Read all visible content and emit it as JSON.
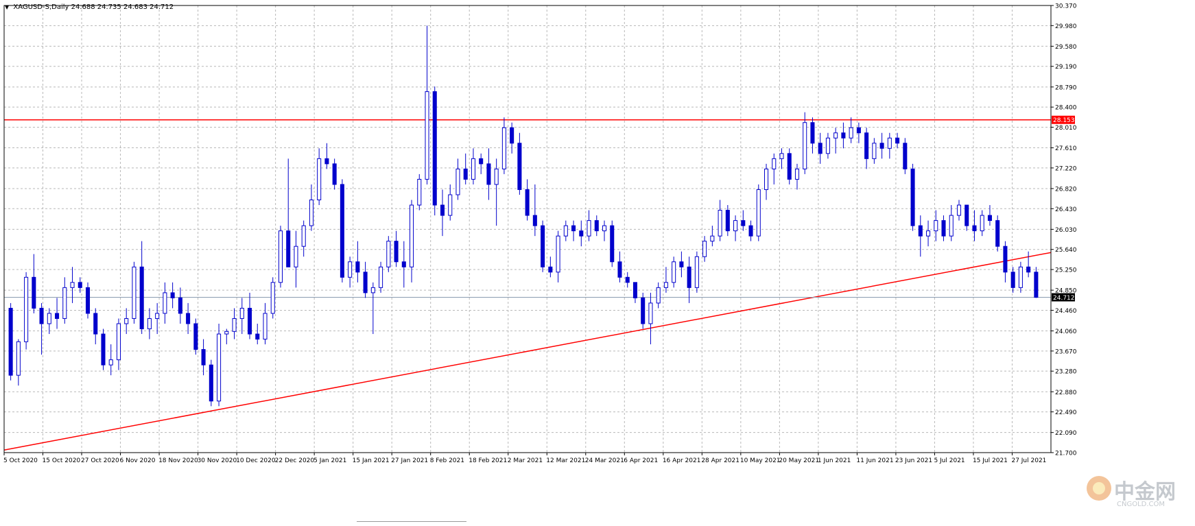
{
  "header": {
    "symbol": "XAGUSD-S",
    "timeframe": "Daily",
    "ohlc": "24.688 24.735 24.683 24.712"
  },
  "price_axis": {
    "ticks": [
      "30.370",
      "29.980",
      "29.580",
      "29.190",
      "28.790",
      "28.400",
      "28.010",
      "27.610",
      "27.220",
      "26.820",
      "26.430",
      "26.030",
      "25.640",
      "25.250",
      "24.850",
      "24.460",
      "24.060",
      "23.670",
      "23.280",
      "22.880",
      "22.490",
      "22.090",
      "21.700"
    ],
    "current_price": "24.712",
    "level_label": "28.153"
  },
  "time_axis": {
    "ticks": [
      "5 Oct 2020",
      "15 Oct 2020",
      "27 Oct 2020",
      "6 Nov 2020",
      "18 Nov 2020",
      "30 Nov 2020",
      "10 Dec 2020",
      "22 Dec 2020",
      "5 Jan 2021",
      "15 Jan 2021",
      "27 Jan 2021",
      "8 Feb 2021",
      "18 Feb 2021",
      "2 Mar 2021",
      "12 Mar 2021",
      "24 Mar 2021",
      "6 Apr 2021",
      "16 Apr 2021",
      "28 Apr 2021",
      "10 May 2021",
      "20 May 2021",
      "1 Jun 2021",
      "11 Jun 2021",
      "23 Jun 2021",
      "5 Jul 2021",
      "15 Jul 2021",
      "27 Jul 2021"
    ]
  },
  "watermark": {
    "brand": "中金网",
    "url": "CNGOLD.COM"
  },
  "colors": {
    "candle": "#0000cc",
    "resistance": "#ff0000",
    "trendline": "#ff0000",
    "grid": "#b8b8b8",
    "current_price_bg": "#000000"
  },
  "chart_data": {
    "type": "candlestick",
    "symbol": "XAGUSD-S",
    "timeframe": "Daily",
    "ylim": [
      21.7,
      30.37
    ],
    "horizontal_line": 28.153,
    "trendline": {
      "start": [
        "5 Oct 2020",
        21.75
      ],
      "end": [
        "27 Jul 2021",
        25.58
      ]
    },
    "current_price": 24.712,
    "x_start": "2020-10-01",
    "x_end": "2021-07-29",
    "candles": [
      [
        24.5,
        24.6,
        23.1,
        23.2
      ],
      [
        23.2,
        23.9,
        23.0,
        23.85
      ],
      [
        23.85,
        25.2,
        23.7,
        25.1
      ],
      [
        25.1,
        25.55,
        24.4,
        24.5
      ],
      [
        24.5,
        24.6,
        23.6,
        24.2
      ],
      [
        24.2,
        24.5,
        24.0,
        24.4
      ],
      [
        24.4,
        24.7,
        24.1,
        24.3
      ],
      [
        24.3,
        25.1,
        24.2,
        24.9
      ],
      [
        24.9,
        25.3,
        24.6,
        25.0
      ],
      [
        25.0,
        25.1,
        24.8,
        24.9
      ],
      [
        24.9,
        25.0,
        24.3,
        24.4
      ],
      [
        24.4,
        24.5,
        23.8,
        24.0
      ],
      [
        24.0,
        24.1,
        23.3,
        23.4
      ],
      [
        23.4,
        23.8,
        23.2,
        23.5
      ],
      [
        23.5,
        24.3,
        23.3,
        24.2
      ],
      [
        24.2,
        24.5,
        24.0,
        24.3
      ],
      [
        24.3,
        25.4,
        24.2,
        25.3
      ],
      [
        25.3,
        25.8,
        24.0,
        24.1
      ],
      [
        24.1,
        24.5,
        23.9,
        24.3
      ],
      [
        24.3,
        24.6,
        24.0,
        24.4
      ],
      [
        24.4,
        25.0,
        24.2,
        24.8
      ],
      [
        24.8,
        25.0,
        24.5,
        24.7
      ],
      [
        24.7,
        24.9,
        24.2,
        24.4
      ],
      [
        24.4,
        24.6,
        24.0,
        24.2
      ],
      [
        24.2,
        24.3,
        23.6,
        23.7
      ],
      [
        23.7,
        23.9,
        23.2,
        23.4
      ],
      [
        23.4,
        23.5,
        22.6,
        22.7
      ],
      [
        22.7,
        24.2,
        22.6,
        24.0
      ],
      [
        24.0,
        24.1,
        23.8,
        24.05
      ],
      [
        24.05,
        24.5,
        23.9,
        24.3
      ],
      [
        24.3,
        24.7,
        24.0,
        24.5
      ],
      [
        24.5,
        24.8,
        23.9,
        24.0
      ],
      [
        24.0,
        24.2,
        23.8,
        23.9
      ],
      [
        23.9,
        24.6,
        23.8,
        24.4
      ],
      [
        24.4,
        25.1,
        24.3,
        25.0
      ],
      [
        25.0,
        26.1,
        24.9,
        26.0
      ],
      [
        26.0,
        27.4,
        25.9,
        25.3
      ],
      [
        25.3,
        26.0,
        24.9,
        25.7
      ],
      [
        25.7,
        26.2,
        25.5,
        26.1
      ],
      [
        26.1,
        26.9,
        26.0,
        26.6
      ],
      [
        26.6,
        27.6,
        26.5,
        27.4
      ],
      [
        27.4,
        27.7,
        27.2,
        27.3
      ],
      [
        27.3,
        27.4,
        26.8,
        26.9
      ],
      [
        26.9,
        27.0,
        25.0,
        25.1
      ],
      [
        25.1,
        25.5,
        24.9,
        25.4
      ],
      [
        25.4,
        25.8,
        25.0,
        25.2
      ],
      [
        25.2,
        25.4,
        24.7,
        24.8
      ],
      [
        24.8,
        25.0,
        24.0,
        24.9
      ],
      [
        24.9,
        25.4,
        24.8,
        25.3
      ],
      [
        25.3,
        25.9,
        25.2,
        25.8
      ],
      [
        25.8,
        26.0,
        25.3,
        25.4
      ],
      [
        25.4,
        25.8,
        24.9,
        25.3
      ],
      [
        25.3,
        26.6,
        25.0,
        26.5
      ],
      [
        26.5,
        27.1,
        26.4,
        27.0
      ],
      [
        27.0,
        29.98,
        26.9,
        28.7
      ],
      [
        28.7,
        28.8,
        26.3,
        26.5
      ],
      [
        26.5,
        26.8,
        25.9,
        26.3
      ],
      [
        26.3,
        26.9,
        26.2,
        26.7
      ],
      [
        26.7,
        27.4,
        26.6,
        27.2
      ],
      [
        27.2,
        27.5,
        26.9,
        27.0
      ],
      [
        27.0,
        27.6,
        26.9,
        27.4
      ],
      [
        27.4,
        27.5,
        27.1,
        27.3
      ],
      [
        27.3,
        27.6,
        26.6,
        26.9
      ],
      [
        26.9,
        27.4,
        26.1,
        27.2
      ],
      [
        27.2,
        28.2,
        27.1,
        28.0
      ],
      [
        28.0,
        28.1,
        27.5,
        27.7
      ],
      [
        27.7,
        27.9,
        26.7,
        26.8
      ],
      [
        26.8,
        27.0,
        26.2,
        26.3
      ],
      [
        26.3,
        26.9,
        25.9,
        26.1
      ],
      [
        26.1,
        26.2,
        25.2,
        25.3
      ],
      [
        25.3,
        25.5,
        25.1,
        25.2
      ],
      [
        25.2,
        26.0,
        25.0,
        25.9
      ],
      [
        25.9,
        26.2,
        25.8,
        26.1
      ],
      [
        26.1,
        26.2,
        25.8,
        26.0
      ],
      [
        26.0,
        26.2,
        25.7,
        25.9
      ],
      [
        25.9,
        26.4,
        25.8,
        26.2
      ],
      [
        26.2,
        26.3,
        25.9,
        26.0
      ],
      [
        26.0,
        26.2,
        25.8,
        26.1
      ],
      [
        26.1,
        26.2,
        25.3,
        25.4
      ],
      [
        25.4,
        25.6,
        25.0,
        25.1
      ],
      [
        25.1,
        25.2,
        24.9,
        25.0
      ],
      [
        25.0,
        25.0,
        24.6,
        24.7
      ],
      [
        24.7,
        24.8,
        24.1,
        24.2
      ],
      [
        24.2,
        24.8,
        23.8,
        24.6
      ],
      [
        24.6,
        25.0,
        24.5,
        24.9
      ],
      [
        24.9,
        25.3,
        24.8,
        25.0
      ],
      [
        25.0,
        25.5,
        24.9,
        25.4
      ],
      [
        25.4,
        25.6,
        25.1,
        25.3
      ],
      [
        25.3,
        25.5,
        24.6,
        24.9
      ],
      [
        24.9,
        25.6,
        24.8,
        25.5
      ],
      [
        25.5,
        25.9,
        25.4,
        25.8
      ],
      [
        25.8,
        26.1,
        25.7,
        25.9
      ],
      [
        25.9,
        26.6,
        25.8,
        26.4
      ],
      [
        26.4,
        26.5,
        25.9,
        26.0
      ],
      [
        26.0,
        26.3,
        25.8,
        26.2
      ],
      [
        26.2,
        26.4,
        26.0,
        26.1
      ],
      [
        26.1,
        26.2,
        25.8,
        25.9
      ],
      [
        25.9,
        26.9,
        25.8,
        26.8
      ],
      [
        26.8,
        27.3,
        26.6,
        27.2
      ],
      [
        27.2,
        27.5,
        26.9,
        27.4
      ],
      [
        27.4,
        27.6,
        27.2,
        27.5
      ],
      [
        27.5,
        27.6,
        26.9,
        27.0
      ],
      [
        27.0,
        27.3,
        26.8,
        27.2
      ],
      [
        27.2,
        28.3,
        27.1,
        28.1
      ],
      [
        28.1,
        28.2,
        27.5,
        27.7
      ],
      [
        27.7,
        27.9,
        27.3,
        27.5
      ],
      [
        27.5,
        27.9,
        27.4,
        27.8
      ],
      [
        27.8,
        28.0,
        27.5,
        27.9
      ],
      [
        27.9,
        28.1,
        27.6,
        27.8
      ],
      [
        27.8,
        28.2,
        27.7,
        28.0
      ],
      [
        28.0,
        28.1,
        27.7,
        27.9
      ],
      [
        27.9,
        28.0,
        27.2,
        27.4
      ],
      [
        27.4,
        27.8,
        27.3,
        27.7
      ],
      [
        27.7,
        27.9,
        27.4,
        27.6
      ],
      [
        27.6,
        27.9,
        27.4,
        27.8
      ],
      [
        27.8,
        27.9,
        27.6,
        27.7
      ],
      [
        27.7,
        27.8,
        27.1,
        27.2
      ],
      [
        27.2,
        27.3,
        26.0,
        26.1
      ],
      [
        26.1,
        26.3,
        25.5,
        25.9
      ],
      [
        25.9,
        26.2,
        25.7,
        26.0
      ],
      [
        26.0,
        26.4,
        25.8,
        26.2
      ],
      [
        26.2,
        26.3,
        25.8,
        25.9
      ],
      [
        25.9,
        26.5,
        25.8,
        26.3
      ],
      [
        26.3,
        26.6,
        26.2,
        26.5
      ],
      [
        26.5,
        26.5,
        26.0,
        26.1
      ],
      [
        26.1,
        26.4,
        25.8,
        26.0
      ],
      [
        26.0,
        26.4,
        25.9,
        26.3
      ],
      [
        26.3,
        26.5,
        26.1,
        26.2
      ],
      [
        26.2,
        26.3,
        25.6,
        25.7
      ],
      [
        25.7,
        25.8,
        25.0,
        25.2
      ],
      [
        25.2,
        25.3,
        24.8,
        24.9
      ],
      [
        24.9,
        25.4,
        24.8,
        25.3
      ],
      [
        25.3,
        25.6,
        25.1,
        25.2
      ],
      [
        25.2,
        25.3,
        24.7,
        24.71
      ]
    ]
  }
}
